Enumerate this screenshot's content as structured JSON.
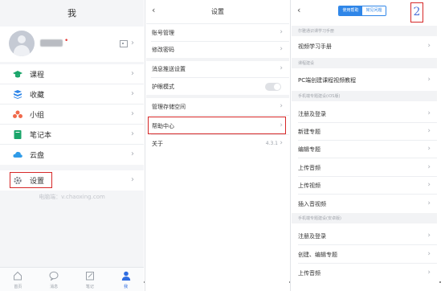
{
  "me_panel": {
    "title": "我",
    "menu": [
      {
        "label": "课程",
        "icon": "graduation-cap-icon",
        "color": "#1aa56a"
      },
      {
        "label": "收藏",
        "icon": "favorites-icon",
        "color": "#2f86e8"
      },
      {
        "label": "小组",
        "icon": "group-icon",
        "color": "#f06a4b"
      },
      {
        "label": "笔记本",
        "icon": "notebook-icon",
        "color": "#1aa56a"
      },
      {
        "label": "云盘",
        "icon": "cloud-icon",
        "color": "#2f9be8"
      },
      {
        "label": "设置",
        "icon": "gear-icon",
        "color": "#7b8089"
      }
    ],
    "domain_text": "电脑端：v.chaoxing.com",
    "tabs": [
      {
        "label": "首页",
        "icon": "home-icon"
      },
      {
        "label": "消息",
        "icon": "message-icon"
      },
      {
        "label": "笔记",
        "icon": "note-icon"
      },
      {
        "label": "我",
        "icon": "person-icon"
      }
    ]
  },
  "settings_panel": {
    "title": "设置",
    "items": [
      "账号管理",
      "修改密码",
      "消息推送设置",
      "护眼模式",
      "管理存储空间",
      "帮助中心",
      "关于"
    ],
    "version": "4.3.1"
  },
  "help_panel": {
    "tabs": [
      "使用帮助",
      "常见问题"
    ],
    "annotation_number": "2",
    "sections": [
      {
        "header": "尔雅通识课学习手册",
        "items": [
          "视频学习手册"
        ]
      },
      {
        "header": "课程建设",
        "items": [
          "PC端创建课程视频教程"
        ]
      },
      {
        "header": "手机端专题建设(iOS版)",
        "items": [
          "注册及登录",
          "新建专题",
          "编辑专题",
          "上传音频",
          "上传视频",
          "插入音视频"
        ]
      },
      {
        "header": "手机端专题建设(安卓版)",
        "items": [
          "注册及登录",
          "创建、编辑专题",
          "上传音频"
        ]
      }
    ]
  },
  "colors": {
    "accent": "#2f86e8",
    "highlight": "#d62828",
    "background": "#f4f5f7"
  }
}
